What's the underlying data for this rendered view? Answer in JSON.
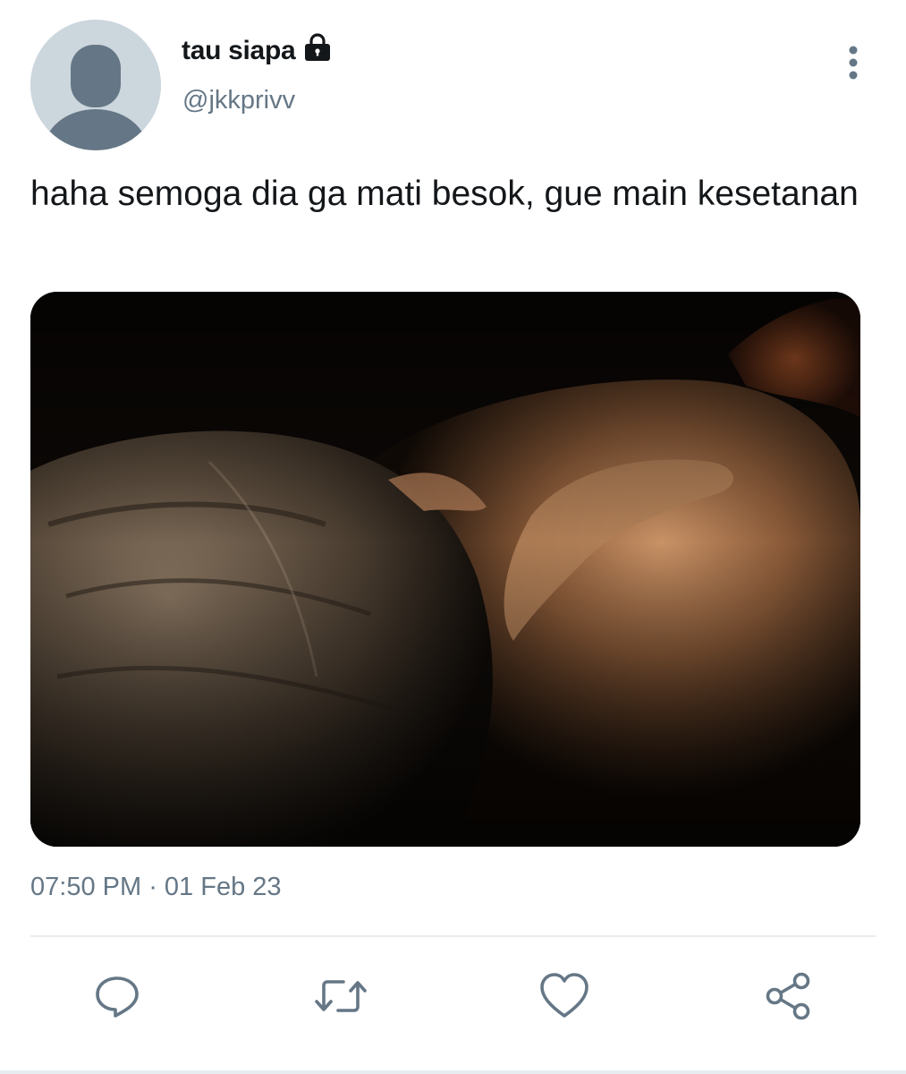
{
  "user": {
    "display_name": "tau siapa",
    "handle": "@jkkprivv",
    "protected_icon": "lock-icon",
    "avatar_icon": "default-avatar-icon"
  },
  "tweet": {
    "text": "haha semoga dia ga mati besok, gue main kesetanan",
    "time": "07:50 PM",
    "separator": " · ",
    "date": "01 Feb 23"
  },
  "actions": {
    "more_icon": "more-vertical-icon",
    "reply_icon": "reply-icon",
    "retweet_icon": "retweet-icon",
    "like_icon": "heart-icon",
    "share_icon": "share-icon"
  },
  "colors": {
    "text_primary": "#14171a",
    "text_secondary": "#657786",
    "icon_gray": "#657786",
    "avatar_bg": "#ccd6dd",
    "avatar_fg": "#657786",
    "divider": "#e6ecf0"
  }
}
